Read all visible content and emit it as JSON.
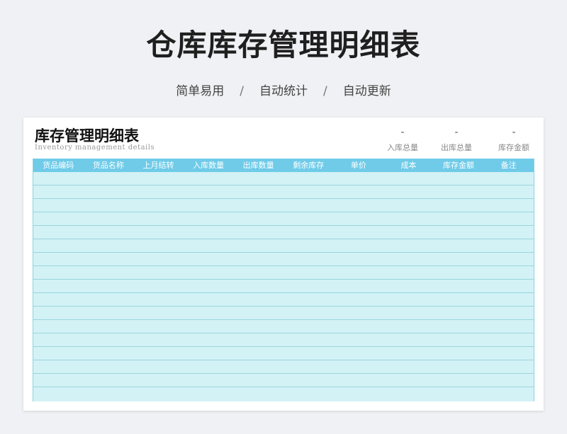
{
  "hero": {
    "title": "仓库库存管理明细表",
    "tags": [
      "简单易用",
      "自动统计",
      "自动更新"
    ],
    "separator": "/"
  },
  "sheet": {
    "title": "库存管理明细表",
    "subtitle": "Inventory management details",
    "summary": [
      {
        "value": "-",
        "label": "入库总量"
      },
      {
        "value": "-",
        "label": "出库总量"
      },
      {
        "value": "-",
        "label": "库存金额"
      }
    ],
    "columns": [
      "货品编码",
      "货品名称",
      "上月结转",
      "入库数量",
      "出库数量",
      "剩余库存",
      "单价",
      "成本",
      "库存金额",
      "备注"
    ],
    "row_count": 16
  },
  "colors": {
    "header_bg": "#6fcbe8",
    "grid_bg": "#d3f2f6",
    "row_line": "#97d6dd"
  }
}
